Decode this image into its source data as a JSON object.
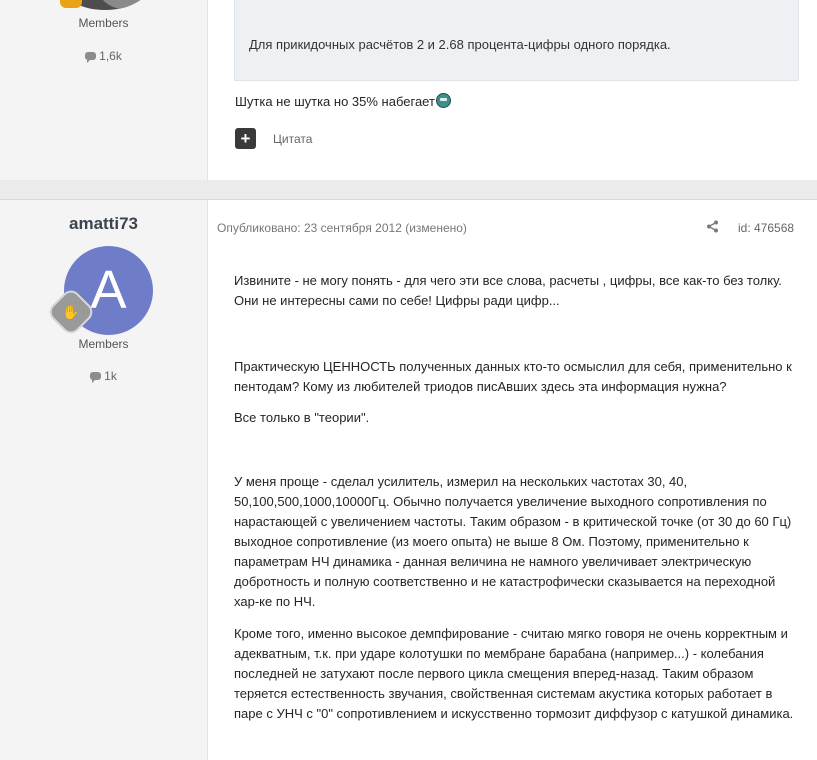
{
  "previous_post": {
    "group": "Members",
    "post_count": "1,6k",
    "quote_text": "Для прикидочных расчётов 2 и 2.68 процента-цифры одного порядка.",
    "body_text": "Шутка не шутка но 35% набегает",
    "quote_button": "Цитата",
    "plus_button": "+"
  },
  "current_post": {
    "username": "amatti73",
    "avatar_letter": "A",
    "group": "Members",
    "post_count": "1k",
    "published": "Опубликовано: 23 сентября 2012 (изменено)",
    "post_id": "id: 476568",
    "paragraphs": [
      "Извините - не могу понять - для чего эти все слова, расчеты , цифры, все как-то без толку. Они не интересны сами по себе! Цифры ради цифр...",
      "Практическую ЦЕННОСТЬ полученных данных кто-то осмыслил для себя, применительно к пентодам? Кому из любителей триодов писАвших здесь эта информация нужна?",
      "Все только в \"теории\".",
      "У меня проще - сделал усилитель, измерил на нескольких частотах 30, 40, 50,100,500,1000,10000Гц. Обычно получается увеличение выходного сопротивления по нарастающей с увеличением частоты. Таким образом - в критической точке (от 30 до 60 Гц) выходное сопротивление (из моего опыта) не выше 8 Ом. Поэтому, применительно к параметрам НЧ динамика - данная величина не намного увеличивает электрическую добротность и полную соответственно и не катастрофически сказывается на переходной хар-ке по НЧ.",
      "Кроме того, именно высокое демпфирование - считаю мягко говоря не очень корректным и адекватным, т.к. при ударе колотушки по мембране барабана (например...) - колебания последней не затухают после первого цикла смещения вперед-назад. Таким образом теряется естественность звучания, свойственная системам акустика которых работает в паре с УНЧ с \"0\" сопротивлением и искусственно тормозит диффузор с катушкой динамика."
    ]
  },
  "icons": {
    "comment": "comment-icon",
    "share": "share-icon",
    "emoji": "grimace-emoji-icon",
    "rank": "rank-badge-icon"
  }
}
